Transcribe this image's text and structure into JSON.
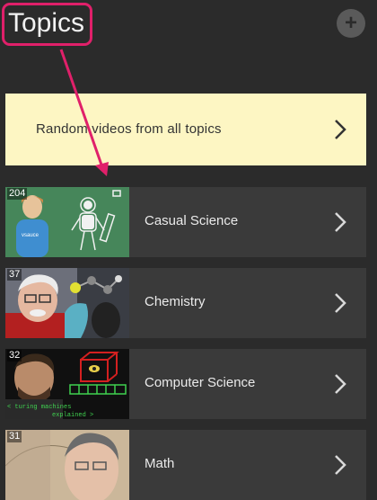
{
  "header": {
    "title": "Topics",
    "add_icon": "plus-icon",
    "add_label": "+"
  },
  "random": {
    "label": "Random videos from all topics",
    "chevron_icon": "chevron-right-icon"
  },
  "topics": [
    {
      "label": "Casual Science",
      "count": "204",
      "thumb": "astronaut-chalkboard"
    },
    {
      "label": "Chemistry",
      "count": "37",
      "thumb": "professor-molecules"
    },
    {
      "label": "Computer Science",
      "count": "32",
      "thumb": "turing-machine"
    },
    {
      "label": "Math",
      "count": "31",
      "thumb": "math-lecturer"
    }
  ],
  "thumb_caption": {
    "line1": "< turing machines",
    "line2": "explained >"
  },
  "colors": {
    "background": "#2b2b2b",
    "row": "#3a3a3a",
    "banner": "#fdf6c3",
    "annotation": "#e0206a"
  }
}
